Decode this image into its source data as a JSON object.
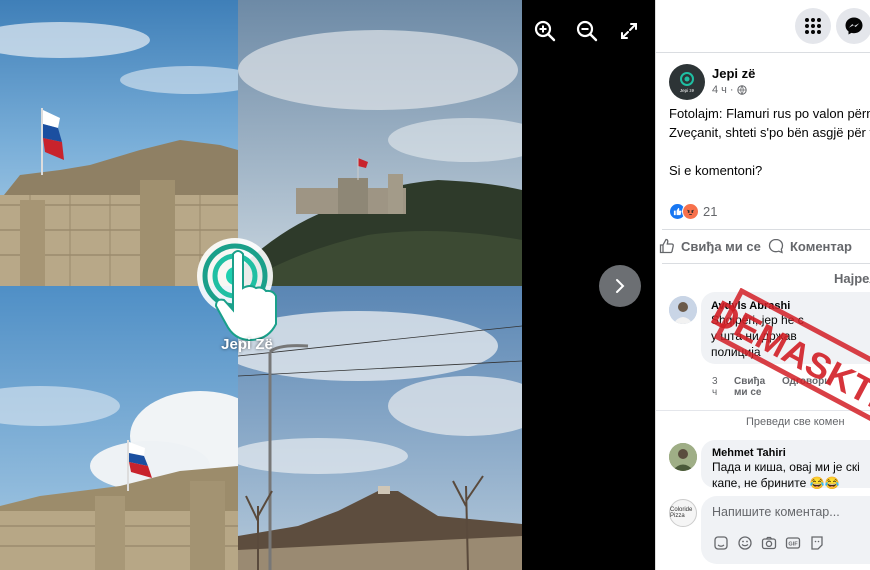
{
  "viewer": {
    "watermark_text": "Jepi Zë",
    "zoom_in_icon": "zoom-in-icon",
    "zoom_out_icon": "zoom-out-icon",
    "fullscreen_icon": "fullscreen-icon",
    "next_icon": "chevron-right-icon"
  },
  "post": {
    "page_name": "Jepi zë",
    "time": "4 ч",
    "audience_icon": "globe-icon",
    "text_line_1": "Fotolajm: Flamuri rus po valon përm",
    "text_line_2": "Zveçanit, shteti s'po bën asgjë për t",
    "text_line_3": "Si e komentoni?",
    "reaction_count": "21",
    "reaction_icons": [
      "like-icon",
      "angry-icon"
    ],
    "actions": {
      "like": "Свиђа ми се",
      "comment": "Коментар"
    },
    "sort_label": "Најрел",
    "avatar_text": "Jepi zë"
  },
  "comments": [
    {
      "author": "Avdyls Abrashi",
      "line_1": "Shqipëri, jep he c",
      "line_2": "у шта ни држав",
      "line_3": "полиција",
      "meta_time": "3 ч",
      "meta_like": "Свиђа ми се",
      "meta_reply": "Одговори"
    },
    {
      "author": "Mehmet Tahiri",
      "line_1": "Пада и киша, овај ми је скі",
      "line_2": "капе, не брините 😂😂"
    }
  ],
  "see_translations": "Преведи све комен",
  "stamp_text": "DEMASKTRA",
  "composer": {
    "placeholder": "Напишите коментар...",
    "avatar_text": "Coloride Pizza",
    "icons": [
      "sticker-icon",
      "emoji-icon",
      "camera-icon",
      "gif-icon",
      "avatar-sticker-icon"
    ]
  },
  "colors": {
    "like_blue": "#1877f2",
    "angry_orange": "#f7714c",
    "stamp_red": "#d21f26",
    "viewer_bg": "#000000"
  }
}
